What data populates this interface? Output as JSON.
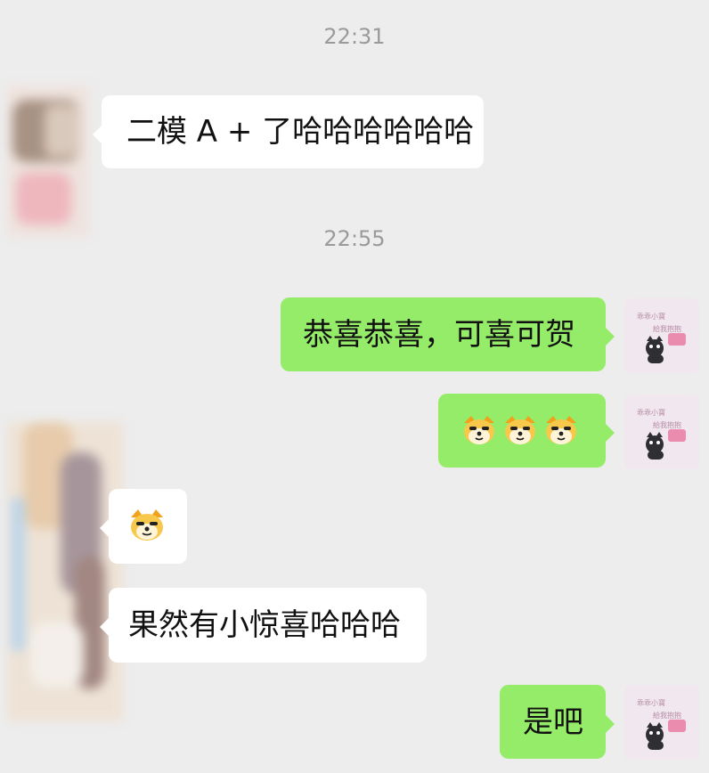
{
  "messages": {
    "timestamp_1": "22:31",
    "msg_1": "二模 A + 了哈哈哈哈哈哈",
    "timestamp_2": "22:55",
    "msg_2": "恭喜恭喜，可喜可贺",
    "msg_3_icon": "dog-emoji-icon x3",
    "msg_4_icon": "dog-emoji-icon",
    "msg_5": "果然有小惊喜哈哈哈",
    "msg_6": "是吧"
  },
  "avatars": {
    "self_sticker_text_1": "乖乖小寶",
    "self_sticker_text_2": "給我抱抱"
  },
  "colors": {
    "background": "#ededed",
    "incoming_bubble": "#ffffff",
    "outgoing_bubble": "#95ec69",
    "timestamp_text": "#9a9a9a",
    "message_text": "#111111"
  }
}
